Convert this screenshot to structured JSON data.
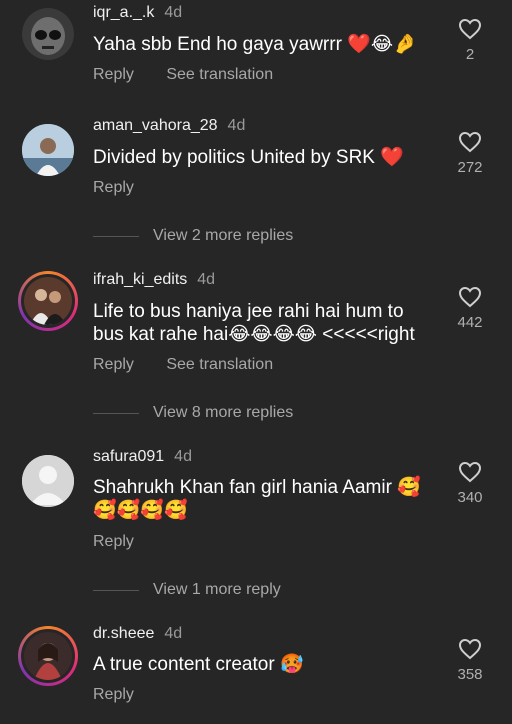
{
  "comments": [
    {
      "username": "iqr_a._.k",
      "time": "4d",
      "text": "Yaha sbb End ho gaya yawrrr ❤️😂🤌",
      "reply": "Reply",
      "translate": "See translation",
      "likes": "2"
    },
    {
      "username": "aman_vahora_28",
      "time": "4d",
      "text": "Divided by politics United by SRK ❤️",
      "reply": "Reply",
      "likes": "272",
      "more_replies": "View 2 more replies"
    },
    {
      "username": "ifrah_ki_edits",
      "time": "4d",
      "text_line1": "Life to bus haniya jee rahi hai hum to",
      "text_line2": "bus kat rahe hai😂😂😂😂 <<<<<right",
      "reply": "Reply",
      "translate": "See translation",
      "likes": "442",
      "more_replies": "View 8 more replies"
    },
    {
      "username": "safura091",
      "time": "4d",
      "text_line1": "Shahrukh Khan fan girl hania Aamir 🥰",
      "text_line2": "🥰🥰🥰🥰",
      "reply": "Reply",
      "likes": "340",
      "more_replies": "View 1 more reply"
    },
    {
      "username": "dr.sheee",
      "time": "4d",
      "text": "A true content creator 🥵",
      "reply": "Reply",
      "likes": "358"
    }
  ],
  "colors": {
    "background": "#262626",
    "secondary_text": "#a8a8a8",
    "heart_outline": "#cfcfcf"
  }
}
